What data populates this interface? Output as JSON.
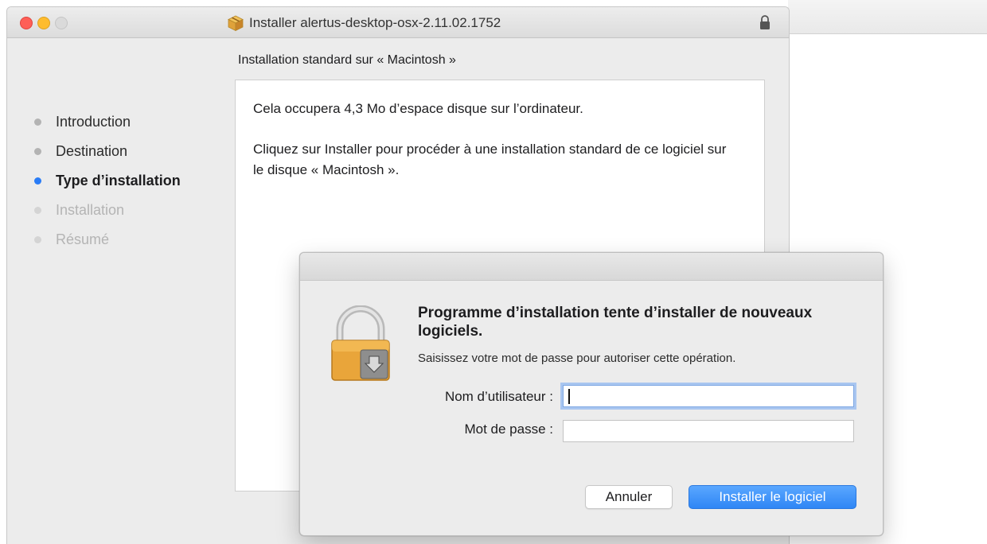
{
  "window": {
    "title": "Installer alertus-desktop-osx-2.11.02.1752",
    "section_title": "Installation standard sur « Macintosh »"
  },
  "sidebar": {
    "steps": [
      {
        "label": "Introduction",
        "state": "done"
      },
      {
        "label": "Destination",
        "state": "done"
      },
      {
        "label": "Type d’installation",
        "state": "current"
      },
      {
        "label": "Installation",
        "state": "future"
      },
      {
        "label": "Résumé",
        "state": "future"
      }
    ]
  },
  "content": {
    "line1": "Cela occupera 4,3 Mo d’espace disque sur l’ordinateur.",
    "line2": "Cliquez sur Installer pour procéder à une installation standard de ce logiciel sur le disque « Macintosh »."
  },
  "auth_dialog": {
    "heading": "Programme d’installation tente d’installer de nouveaux logiciels.",
    "subtext": "Saisissez votre mot de passe pour autoriser cette opération.",
    "username_label": "Nom d’utilisateur :",
    "username_value": "",
    "password_label": "Mot de passe :",
    "password_value": "",
    "cancel_label": "Annuler",
    "install_label": "Installer le logiciel"
  },
  "colors": {
    "accent": "#2a7cf6",
    "close": "#fe5f57",
    "minimize": "#febc2e"
  }
}
